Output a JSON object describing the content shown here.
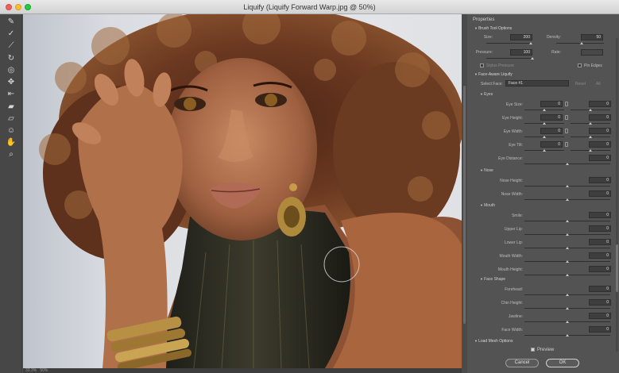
{
  "window": {
    "title": "Liquify (Liquify Forward Warp.jpg @ 50%)"
  },
  "tools": [
    "forward-warp-tool",
    "reconstruct-tool",
    "smooth-tool",
    "twirl-clockwise-tool",
    "pucker-tool",
    "bloat-tool",
    "push-left-tool",
    "freeze-mask-tool",
    "thaw-mask-tool",
    "face-tool",
    "hand-tool",
    "zoom-tool"
  ],
  "status": {
    "zoom": "33.3%",
    "mode": "50%"
  },
  "panel": {
    "title": "Properties",
    "brush": {
      "header": "Brush Tool Options",
      "size_label": "Size:",
      "size": "200",
      "density_label": "Density:",
      "density": "50",
      "pressure_label": "Pressure:",
      "pressure": "100",
      "rate_label": "Rate:",
      "rate": "",
      "stylus_label": "Stylus Pressure",
      "pin_edges_label": "Pin Edges"
    },
    "face": {
      "header": "Face-Aware Liquify",
      "select_face_label": "Select Face:",
      "select_face_value": "Face #1",
      "reset_label": "Reset",
      "all_label": "All",
      "eyes": {
        "header": "Eyes",
        "rows": [
          {
            "label": "Eye Size:",
            "left": "0",
            "right": "0"
          },
          {
            "label": "Eye Height:",
            "left": "0",
            "right": "0"
          },
          {
            "label": "Eye Width:",
            "left": "0",
            "right": "0"
          },
          {
            "label": "Eye Tilt:",
            "left": "0",
            "right": "0"
          }
        ],
        "distance_label": "Eye Distance:",
        "distance": "0"
      },
      "nose": {
        "header": "Nose",
        "rows": [
          {
            "label": "Nose Height:",
            "value": "0"
          },
          {
            "label": "Nose Width:",
            "value": "0"
          }
        ]
      },
      "mouth": {
        "header": "Mouth",
        "rows": [
          {
            "label": "Smile:",
            "value": "0"
          },
          {
            "label": "Upper Lip:",
            "value": "0"
          },
          {
            "label": "Lower Lip:",
            "value": "0"
          },
          {
            "label": "Mouth Width:",
            "value": "0"
          },
          {
            "label": "Mouth Height:",
            "value": "0"
          }
        ]
      },
      "shape": {
        "header": "Face Shape",
        "rows": [
          {
            "label": "Forehead:",
            "value": "0"
          },
          {
            "label": "Chin Height:",
            "value": "0"
          },
          {
            "label": "Jawline:",
            "value": "0"
          },
          {
            "label": "Face Width:",
            "value": "0"
          }
        ]
      }
    },
    "load_mesh_header": "Load Mesh Options",
    "preview_label": "Preview",
    "cancel_label": "Cancel",
    "ok_label": "OK"
  }
}
